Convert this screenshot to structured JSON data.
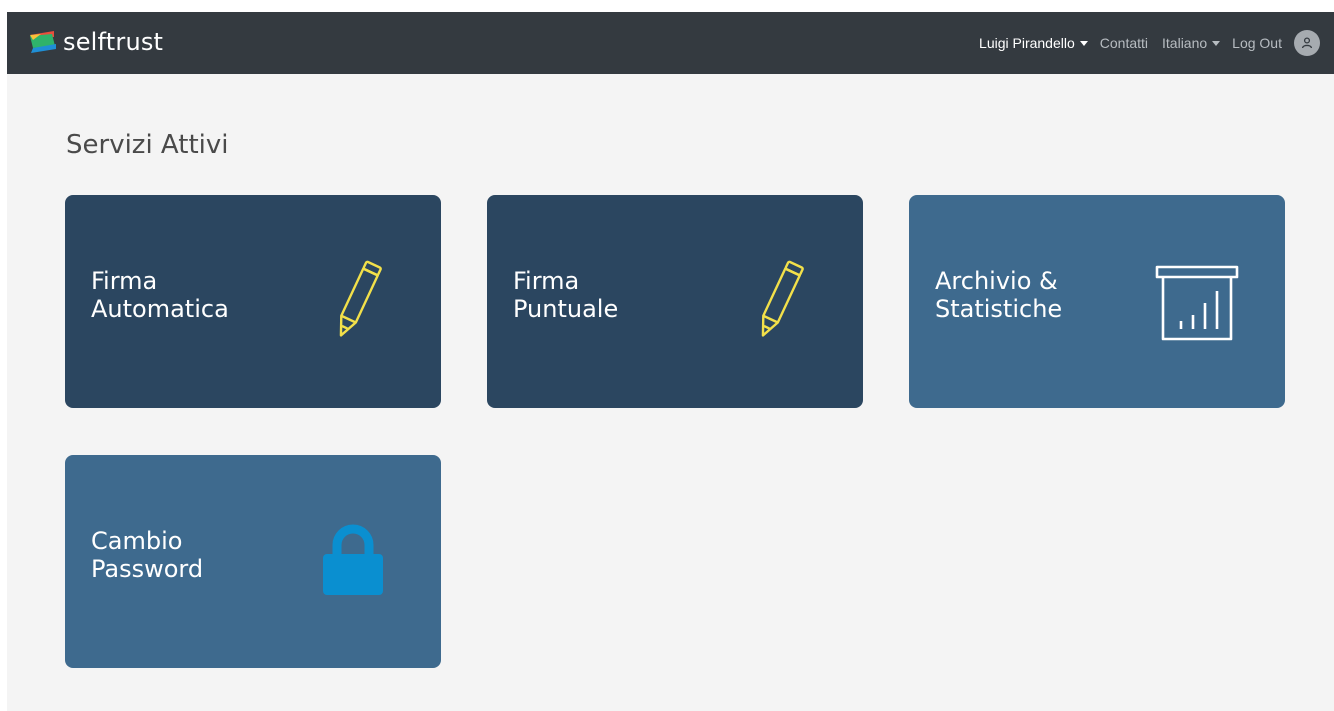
{
  "app": {
    "brand": "selftrust"
  },
  "nav": {
    "user_name": "Luigi Pirandello",
    "contacts": "Contatti",
    "language": "Italiano",
    "logout": "Log Out",
    "avatar_icon": "user-icon"
  },
  "main": {
    "title": "Servizi Attivi",
    "services": [
      {
        "label_line1": "Firma",
        "label_line2": "Automatica",
        "icon": "pencil-icon"
      },
      {
        "label_line1": "Firma",
        "label_line2": "Puntuale",
        "icon": "pencil-icon"
      },
      {
        "label_line1": "Archivio &",
        "label_line2": "Statistiche",
        "icon": "archive-chart-icon"
      },
      {
        "label_line1": "Cambio",
        "label_line2": "Password",
        "icon": "lock-icon"
      }
    ]
  },
  "colors": {
    "navbar": "#343a40",
    "card_dark": "#2b4660",
    "card_light": "#3e6a8e",
    "pencil": "#f2e04a",
    "lock": "#0a8fd0",
    "background": "#f4f4f4"
  }
}
